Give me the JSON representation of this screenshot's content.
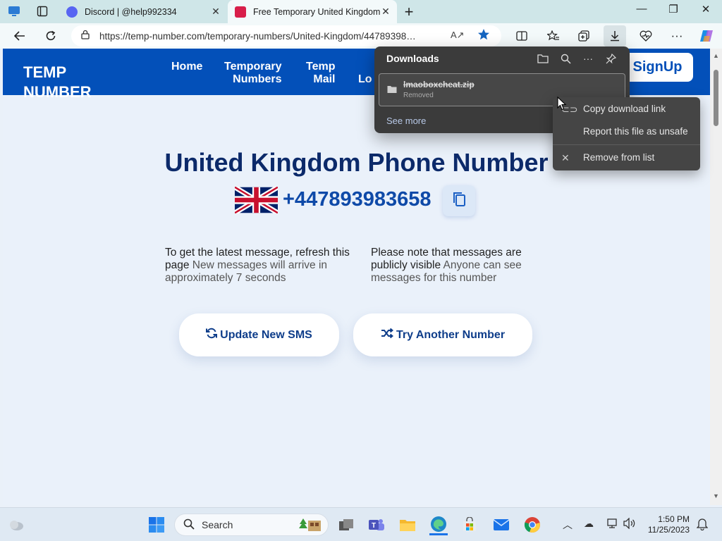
{
  "tabs": [
    {
      "title": "Discord | @help992334",
      "close": "✕"
    },
    {
      "title": "Free Temporary United Kingdom",
      "close": "✕"
    }
  ],
  "address": {
    "url": "https://temp-number.com/temporary-numbers/United-Kingdom/44789398…"
  },
  "site": {
    "logo_line1": "TEMP",
    "logo_line2": "NUMBER",
    "nav": [
      "Home",
      "Temporary\nNumbers",
      "Temp\nMail",
      "Lo"
    ],
    "signup": "SignUp"
  },
  "main": {
    "title": "United Kingdom Phone Number",
    "phone": "+447893983658",
    "note1_a": "To get the latest message, refresh this page",
    "note1_b": " New messages will arrive in approximately 7 seconds",
    "note2_a": "Please note that messages are publicly visible",
    "note2_b": " Anyone can see messages for this number",
    "update_btn": "Update New SMS",
    "try_btn": "Try Another Number"
  },
  "downloads": {
    "title": "Downloads",
    "file": "lmaoboxcheat.zip",
    "status": "Removed",
    "see_more": "See more"
  },
  "context_menu": {
    "copy": "Copy download link",
    "report": "Report this file as unsafe",
    "remove": "Remove from list"
  },
  "taskbar": {
    "search": "Search",
    "time": "1:50 PM",
    "date": "11/25/2023"
  },
  "colors": {
    "brand": "#0350b9",
    "title": "#0c2a6a",
    "phone": "#0f4aa8"
  }
}
